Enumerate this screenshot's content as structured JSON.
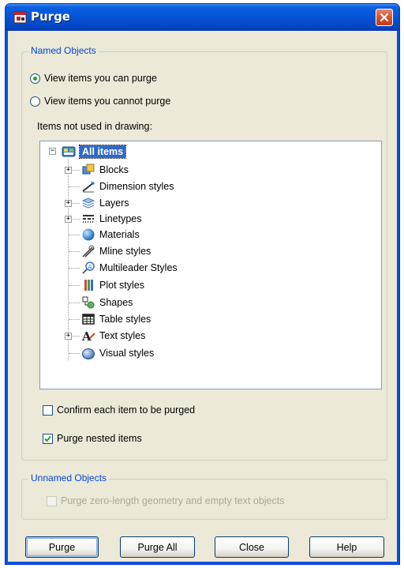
{
  "window": {
    "title": "Purge"
  },
  "named_objects": {
    "group_title": "Named Objects",
    "radio_can_purge": {
      "label": "View items you can purge",
      "selected": true
    },
    "radio_cannot_purge": {
      "label": "View items you cannot purge",
      "selected": false
    },
    "tree_label": "Items not used in drawing:",
    "tree": {
      "root": "All items",
      "items": [
        {
          "label": "Blocks",
          "icon": "blocks-icon",
          "expandable": true
        },
        {
          "label": "Dimension styles",
          "icon": "dimension-styles-icon",
          "expandable": false
        },
        {
          "label": "Layers",
          "icon": "layers-icon",
          "expandable": true
        },
        {
          "label": "Linetypes",
          "icon": "linetypes-icon",
          "expandable": true
        },
        {
          "label": "Materials",
          "icon": "materials-icon",
          "expandable": false
        },
        {
          "label": "Mline styles",
          "icon": "mline-styles-icon",
          "expandable": false
        },
        {
          "label": "Multileader Styles",
          "icon": "multileader-styles-icon",
          "expandable": false
        },
        {
          "label": "Plot styles",
          "icon": "plot-styles-icon",
          "expandable": false
        },
        {
          "label": "Shapes",
          "icon": "shapes-icon",
          "expandable": false
        },
        {
          "label": "Table styles",
          "icon": "table-styles-icon",
          "expandable": false
        },
        {
          "label": "Text styles",
          "icon": "text-styles-icon",
          "expandable": true
        },
        {
          "label": "Visual styles",
          "icon": "visual-styles-icon",
          "expandable": false
        }
      ]
    },
    "confirm_each": {
      "label": "Confirm each item to be purged",
      "checked": false
    },
    "purge_nested": {
      "label": "Purge nested items",
      "checked": true
    }
  },
  "unnamed_objects": {
    "group_title": "Unnamed Objects",
    "zero_length": {
      "label": "Purge zero-length geometry and empty text objects",
      "checked": false,
      "enabled": false
    }
  },
  "buttons": {
    "purge": "Purge",
    "purge_all": "Purge All",
    "close": "Close",
    "help": "Help"
  },
  "colors": {
    "titlebar": "#0653D6",
    "dialog_bg": "#ECE9D8",
    "group_title": "#0046D5",
    "selection": "#316AC5",
    "close_button": "#D8522E"
  }
}
